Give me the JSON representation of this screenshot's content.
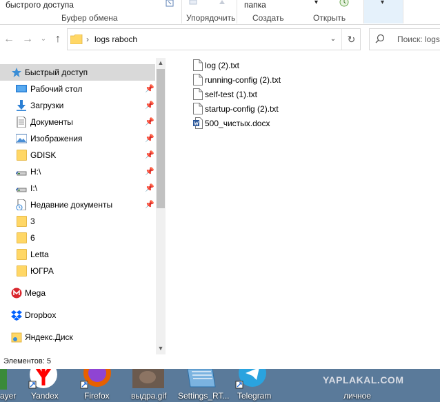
{
  "ribbon": {
    "quick_access_fragment": "быстрого доступа",
    "group_clipboard": "Буфер обмена",
    "group_organize": "Упорядочить",
    "folder_fragment": "папка",
    "group_create": "Создать",
    "group_open": "Открыть"
  },
  "address": {
    "path": "logs raboch",
    "search_placeholder": "Поиск: logs"
  },
  "nav": {
    "quick_access": "Быстрый доступ",
    "items": [
      {
        "label": "Рабочий стол",
        "icon": "desktop-icon",
        "pinned": true
      },
      {
        "label": "Загрузки",
        "icon": "download-icon",
        "pinned": true
      },
      {
        "label": "Документы",
        "icon": "documents-icon",
        "pinned": true
      },
      {
        "label": "Изображения",
        "icon": "pictures-icon",
        "pinned": true
      },
      {
        "label": "GDISK",
        "icon": "folder-icon",
        "pinned": true
      },
      {
        "label": "H:\\",
        "icon": "drive-icon",
        "pinned": true
      },
      {
        "label": "I:\\",
        "icon": "drive-icon",
        "pinned": true
      },
      {
        "label": "Недавние документы",
        "icon": "recent-docs-icon",
        "pinned": true
      },
      {
        "label": "3",
        "icon": "folder-icon",
        "pinned": false
      },
      {
        "label": "6",
        "icon": "folder-icon",
        "pinned": false
      },
      {
        "label": "Letta",
        "icon": "folder-icon",
        "pinned": false
      },
      {
        "label": "ЮГРА",
        "icon": "folder-icon",
        "pinned": false
      }
    ],
    "mega": "Mega",
    "dropbox": "Dropbox",
    "yandex_disk": "Яндекс.Диск"
  },
  "files": [
    {
      "name": "log (2).txt",
      "type": "txt"
    },
    {
      "name": "running-config (2).txt",
      "type": "txt"
    },
    {
      "name": "self-test (1).txt",
      "type": "txt"
    },
    {
      "name": "startup-config (2).txt",
      "type": "txt"
    },
    {
      "name": "500_чистых.docx",
      "type": "docx"
    }
  ],
  "status": {
    "items_count": "Элементов: 5"
  },
  "desktop": {
    "icons": [
      {
        "label": "ayer"
      },
      {
        "label": "Yandex"
      },
      {
        "label": "Firefox"
      },
      {
        "label": "выдра.gif"
      },
      {
        "label": "Settings_RT..."
      },
      {
        "label": "Telegram"
      },
      {
        "label": "личное"
      }
    ],
    "watermark": "YAPLAKAL.COM"
  },
  "colors": {
    "selection": "#d9d9d9",
    "folder": "#ffd766",
    "word_blue": "#2b579a",
    "desktop_bg": "#5a7a9a"
  }
}
